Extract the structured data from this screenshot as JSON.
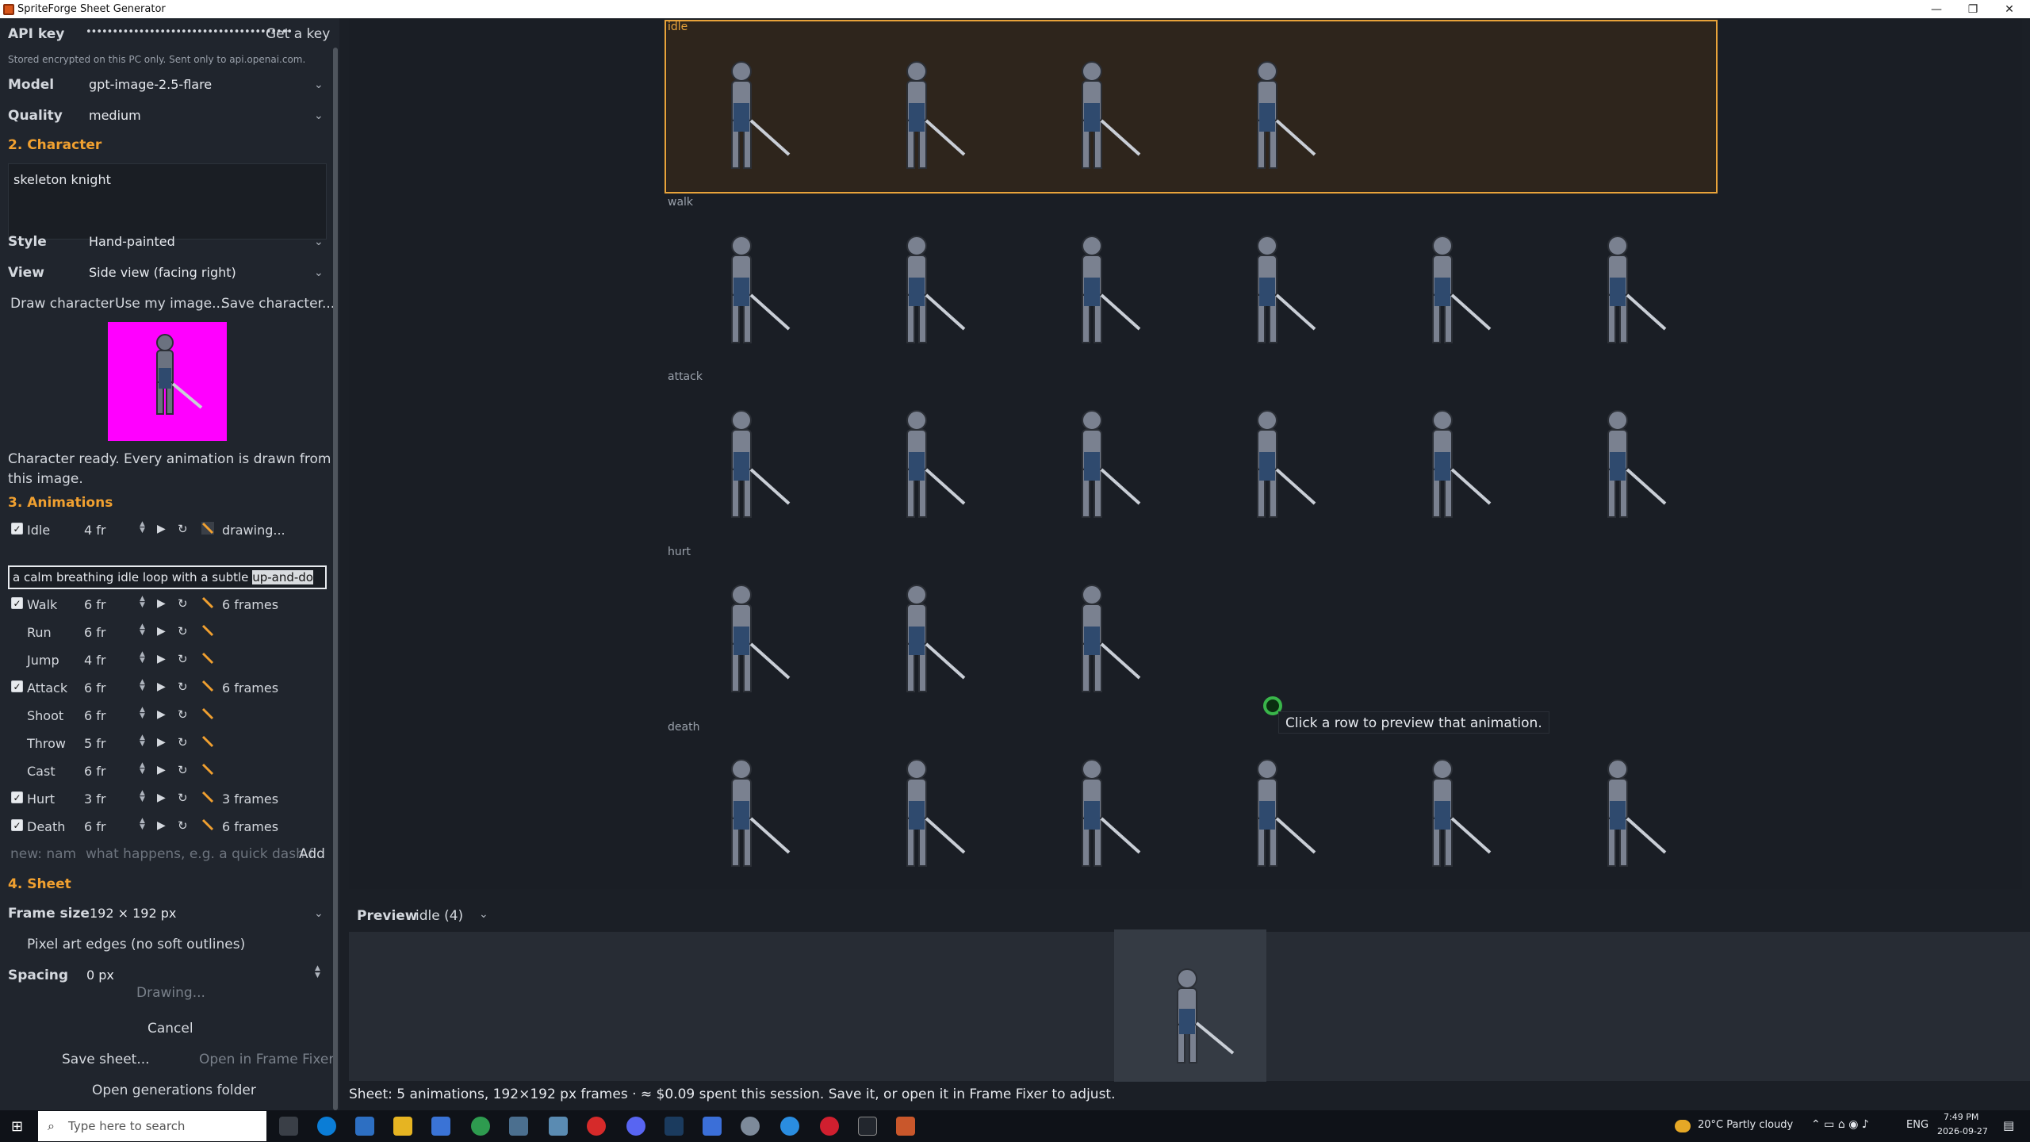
{
  "window": {
    "title": "SpriteForge Sheet Generator"
  },
  "api": {
    "label": "API key",
    "masked": "•••••••••••••••••••••••••••••••••••••••",
    "get_key": "Get a key",
    "note": "Stored encrypted on this PC only. Sent only to api.openai.com."
  },
  "model": {
    "label": "Model",
    "value": "gpt-image-2.5-flare"
  },
  "quality": {
    "label": "Quality",
    "value": "medium"
  },
  "character": {
    "section": "2. Character",
    "text": "skeleton knight",
    "style_label": "Style",
    "style_value": "Hand-painted",
    "view_label": "View",
    "view_value": "Side view (facing right)",
    "draw": "Draw character",
    "use_image": "Use my image...",
    "save": "Save character...",
    "status": "Character ready. Every animation is drawn from",
    "status2": "this image."
  },
  "animations": {
    "section": "3. Animations",
    "prompt_pre": "a calm breathing idle loop with a subtle ",
    "prompt_sel": "up-and-do",
    "rows": [
      {
        "name": "Idle",
        "frames": "4 fr",
        "checked": true,
        "status": "drawing..."
      },
      {
        "name": "Walk",
        "frames": "6 fr",
        "checked": true,
        "status": "6 frames"
      },
      {
        "name": "Run",
        "frames": "6 fr",
        "checked": false,
        "status": ""
      },
      {
        "name": "Jump",
        "frames": "4 fr",
        "checked": false,
        "status": ""
      },
      {
        "name": "Attack",
        "frames": "6 fr",
        "checked": true,
        "status": "6 frames"
      },
      {
        "name": "Shoot",
        "frames": "6 fr",
        "checked": false,
        "status": ""
      },
      {
        "name": "Throw",
        "frames": "5 fr",
        "checked": false,
        "status": ""
      },
      {
        "name": "Cast",
        "frames": "6 fr",
        "checked": false,
        "status": ""
      },
      {
        "name": "Hurt",
        "frames": "3 fr",
        "checked": true,
        "status": "3 frames"
      },
      {
        "name": "Death",
        "frames": "6 fr",
        "checked": true,
        "status": "6 frames"
      }
    ],
    "new_name_placeholder": "new: nam",
    "new_desc_placeholder": "what happens, e.g. a quick dash f",
    "add": "Add"
  },
  "sheet": {
    "section": "4. Sheet",
    "frame_label": "Frame size",
    "frame_value": "192 × 192 px",
    "pixel": "Pixel art edges (no soft outlines)",
    "spacing_label": "Spacing",
    "spacing_value": "0 px",
    "drawing": "Drawing...",
    "cancel": "Cancel",
    "save_sheet": "Save sheet...",
    "open_fixer": "Open in Frame Fixer",
    "open_folder": "Open generations folder"
  },
  "canvas": {
    "rows": [
      "idle",
      "walk",
      "attack",
      "hurt",
      "death"
    ],
    "frame_counts": [
      4,
      6,
      6,
      3,
      6
    ],
    "tooltip": "Click a row to preview that animation."
  },
  "preview": {
    "label": "Preview",
    "value": "idle (4)"
  },
  "status": "Sheet: 5 animations, 192×192 px frames · ≈ $0.09 spent this session. Save it, or open it in Frame Fixer to adjust.",
  "taskbar": {
    "search": "Type here to search",
    "weather": "20°C  Partly cloudy",
    "lang": "ENG",
    "time": "7:49 PM",
    "date": "2026-09-27"
  }
}
